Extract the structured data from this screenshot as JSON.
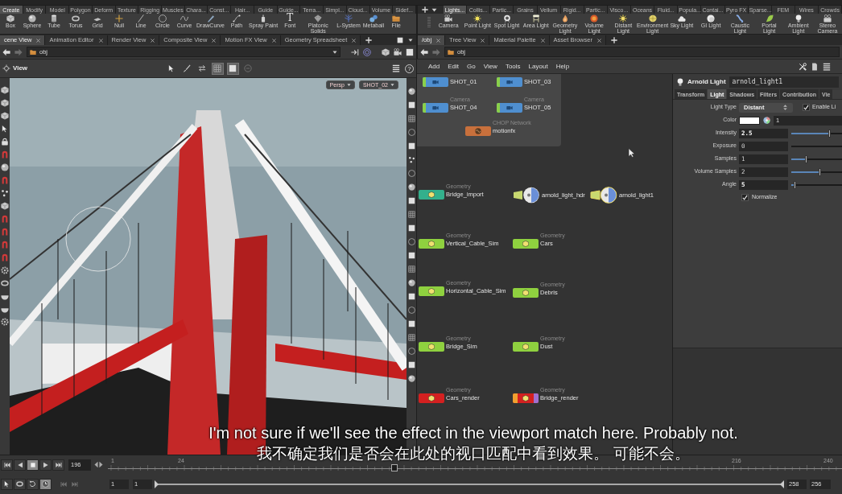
{
  "shelf_left": {
    "tabs": [
      {
        "label": "Create",
        "selected": true
      },
      {
        "label": "Modify",
        "selected": false
      },
      {
        "label": "Model",
        "selected": false
      },
      {
        "label": "Polygon",
        "selected": false
      },
      {
        "label": "Deform",
        "selected": false
      },
      {
        "label": "Texture",
        "selected": false
      },
      {
        "label": "Rigging",
        "selected": false
      },
      {
        "label": "Muscles",
        "selected": false
      },
      {
        "label": "Chara...",
        "selected": false
      },
      {
        "label": "Const...",
        "selected": false
      },
      {
        "label": "Hair...",
        "selected": false
      },
      {
        "label": "Guide",
        "selected": false
      },
      {
        "label": "Guide...",
        "selected": false
      },
      {
        "label": "Terra...",
        "selected": false
      },
      {
        "label": "Simpl...",
        "selected": false
      },
      {
        "label": "Cloud...",
        "selected": false
      },
      {
        "label": "Volume",
        "selected": false
      },
      {
        "label": "Sidef...",
        "selected": false
      }
    ],
    "tools": [
      {
        "label": "Box"
      },
      {
        "label": "Sphere"
      },
      {
        "label": "Tube"
      },
      {
        "label": "Torus"
      },
      {
        "label": "Grid"
      },
      {
        "label": "Null"
      },
      {
        "label": "Line"
      },
      {
        "label": "Circle"
      },
      {
        "label": "Curve"
      },
      {
        "label": "DrawCurve"
      },
      {
        "label": "Path"
      },
      {
        "label": "Spray Paint"
      },
      {
        "label": "Font",
        "glyph": "T"
      },
      {
        "label": "Platonic Solids"
      },
      {
        "label": "L-System"
      },
      {
        "label": "Metaball"
      },
      {
        "label": "File"
      }
    ]
  },
  "shelf_right": {
    "tabs": [
      {
        "label": "Lights...",
        "selected": true
      },
      {
        "label": "Collis...",
        "selected": false
      },
      {
        "label": "Partic...",
        "selected": false
      },
      {
        "label": "Grains",
        "selected": false
      },
      {
        "label": "Vellum",
        "selected": false
      },
      {
        "label": "Rigid...",
        "selected": false
      },
      {
        "label": "Partic...",
        "selected": false
      },
      {
        "label": "Visco...",
        "selected": false
      },
      {
        "label": "Oceans",
        "selected": false
      },
      {
        "label": "Fluid...",
        "selected": false
      },
      {
        "label": "Popula...",
        "selected": false
      },
      {
        "label": "Contai...",
        "selected": false
      },
      {
        "label": "Pyro FX",
        "selected": false
      },
      {
        "label": "Sparse...",
        "selected": false
      },
      {
        "label": "FEM",
        "selected": false
      },
      {
        "label": "Wires",
        "selected": false
      },
      {
        "label": "Crowds",
        "selected": false
      }
    ],
    "tools": [
      {
        "label": "Camera"
      },
      {
        "label": "Point Light"
      },
      {
        "label": "Spot Light"
      },
      {
        "label": "Area Light"
      },
      {
        "label": "Geometry Light"
      },
      {
        "label": "Volume Light"
      },
      {
        "label": "Distant Light"
      },
      {
        "label": "Environment Light"
      },
      {
        "label": "Sky Light"
      },
      {
        "label": "GI Light"
      },
      {
        "label": "Caustic Light"
      },
      {
        "label": "Portal Light"
      },
      {
        "label": "Ambient Light"
      },
      {
        "label": "Stereo Camera"
      }
    ]
  },
  "scene_view": {
    "tabs": [
      {
        "label": "cene View",
        "selected": true
      },
      {
        "label": "Animation Editor",
        "selected": false
      },
      {
        "label": "Render View",
        "selected": false
      },
      {
        "label": "Composite View",
        "selected": false
      },
      {
        "label": "Motion FX View",
        "selected": false
      },
      {
        "label": "Geometry Spreadsheet",
        "selected": false
      }
    ],
    "path": "obj",
    "toolbar_label": "View",
    "toolbar_toggles": [
      {
        "on": false
      },
      {
        "on": false
      },
      {
        "on": false
      },
      {
        "on": true
      },
      {
        "on": true
      },
      {
        "on": false
      }
    ],
    "help": "?",
    "camera_menus": [
      "Persp",
      "SHOT_02"
    ]
  },
  "network": {
    "tabs": [
      {
        "label": "/obj",
        "selected": true
      },
      {
        "label": "Tree View",
        "selected": false
      },
      {
        "label": "Material Palette",
        "selected": false
      },
      {
        "label": "Asset Browser",
        "selected": false
      }
    ],
    "path": "obj",
    "menu": [
      "Add",
      "Edit",
      "Go",
      "View",
      "Tools",
      "Layout",
      "Help"
    ],
    "network_box": {
      "nodes": [
        {
          "kind": "camera",
          "name": "SHOT_01",
          "color": "#4f8fd0",
          "selected": false,
          "flags": false
        },
        {
          "kind": "camera",
          "name": "SHOT_03",
          "color": "#4f8fd0",
          "selected": false,
          "flags": false
        },
        {
          "kind": "camera",
          "type": "Camera",
          "name": "SHOT_04",
          "color": "#4f8fd0",
          "selected": false,
          "flags": false
        },
        {
          "kind": "camera",
          "type": "Camera",
          "name": "SHOT_05",
          "color": "#4f8fd0",
          "selected": false,
          "flags": false
        },
        {
          "kind": "chop",
          "type": "CHOP Network",
          "name": "motionfx",
          "color": "#c8703c",
          "selected": false,
          "flags": false
        }
      ]
    },
    "nodes": [
      {
        "kind": "geometry",
        "type": "Geometry",
        "name": "Bridge_import",
        "color": "#33b08c",
        "selected": false,
        "flags": false
      },
      {
        "kind": "light",
        "name": "arnold_light_hdr",
        "selected": false,
        "flags": false
      },
      {
        "kind": "light",
        "name": "arnold_light1",
        "selected": true,
        "flags": false
      },
      {
        "kind": "geometry",
        "type": "Geometry",
        "name": "Vertical_Cable_Sim",
        "color": "#8fd13f",
        "selected": false,
        "flags": false
      },
      {
        "kind": "geometry",
        "type": "Geometry",
        "name": "Cars",
        "color": "#8fd13f",
        "selected": false,
        "flags": false
      },
      {
        "kind": "geometry",
        "type": "Geometry",
        "name": "Horizontal_Cable_Sim",
        "color": "#8fd13f",
        "selected": false,
        "flags": false
      },
      {
        "kind": "geometry",
        "type": "Geometry",
        "name": "Debris",
        "color": "#8fd13f",
        "selected": false,
        "flags": false
      },
      {
        "kind": "geometry",
        "type": "Geometry",
        "name": "Bridge_Sim",
        "color": "#8fd13f",
        "selected": false,
        "flags": false
      },
      {
        "kind": "geometry",
        "type": "Geometry",
        "name": "Dust",
        "color": "#8fd13f",
        "selected": false,
        "flags": false
      },
      {
        "kind": "geometry",
        "type": "Geometry",
        "name": "Cars_render",
        "color": "#d42020",
        "selected": false,
        "flags": false
      },
      {
        "kind": "geometry",
        "type": "Geometry",
        "name": "Bridge_render",
        "color": "#d42020",
        "selected": false,
        "flags": true
      }
    ]
  },
  "parameters": {
    "node_type": "Arnold Light",
    "node_name": "arnold_light1",
    "tabs": [
      {
        "label": "Transform",
        "selected": false
      },
      {
        "label": "Light",
        "selected": true
      },
      {
        "label": "Shadows",
        "selected": false
      },
      {
        "label": "Filters",
        "selected": false
      },
      {
        "label": "Contribution",
        "selected": false
      },
      {
        "label": "Vie",
        "selected": false
      }
    ],
    "rows": [
      {
        "kind": "menu",
        "label": "Light Type",
        "value": "Distant",
        "toggle": {
          "label": "Enable Li",
          "checked": true
        }
      },
      {
        "kind": "color",
        "label": "Color",
        "color": "#ffffff",
        "value": "1"
      },
      {
        "kind": "slider",
        "label": "Intensity",
        "value": "2.5",
        "modified": true,
        "level": 0.74
      },
      {
        "kind": "slider",
        "label": "Exposure",
        "value": "0",
        "modified": false
      },
      {
        "kind": "slider",
        "label": "Samples",
        "value": "1",
        "modified": false,
        "level": 0.28
      },
      {
        "kind": "slider",
        "label": "Volume Samples",
        "value": "2",
        "modified": false,
        "level": 0.56
      },
      {
        "kind": "slider",
        "label": "Angle",
        "value": "5",
        "modified": true,
        "level": 0.07
      },
      {
        "kind": "checkbox",
        "label": "Normalize",
        "checked": true
      }
    ]
  },
  "timeline": {
    "transport": [
      {
        "selected": false
      },
      {
        "selected": false
      },
      {
        "selected": true
      },
      {
        "selected": false
      },
      {
        "selected": false
      }
    ],
    "frame": "196",
    "ticks": [
      "1",
      "24",
      "216",
      "240"
    ],
    "playhead": {
      "level": 0.39
    },
    "tools": [
      {
        "on": false
      },
      {
        "on": false
      },
      {
        "on": false
      },
      {
        "on": true
      }
    ],
    "start": "1",
    "range_start": "1",
    "range": {
      "level": 1
    },
    "range_end": "258",
    "end": "256"
  },
  "subtitles": [
    "I'm not sure if we'll see the effect in the viewport match here. Probably not.",
    "我不确定我们是否会在此处的视口匹配中看到效果。 可能不会。"
  ]
}
